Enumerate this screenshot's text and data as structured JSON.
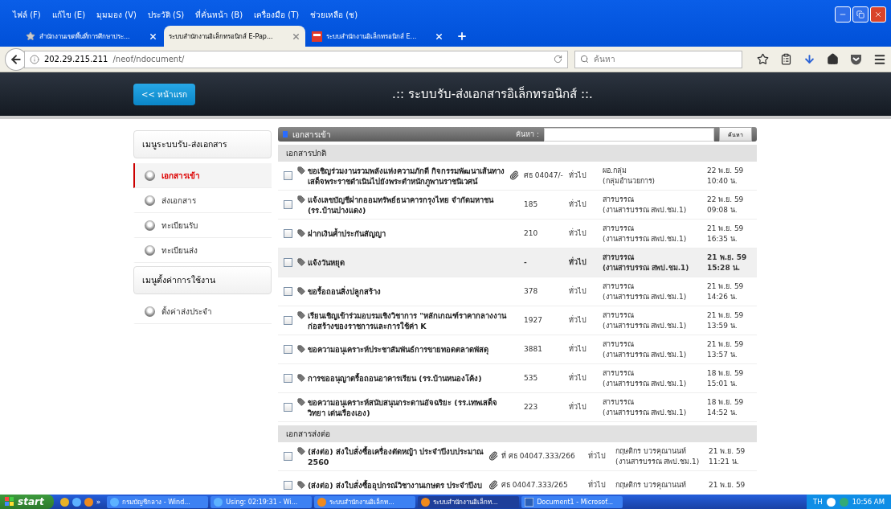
{
  "menu_bar": [
    "ไฟล์ (F)",
    "แก้ไข (E)",
    "มุมมอง (V)",
    "ประวัติ (S)",
    "ที่คั่นหน้า (B)",
    "เครื่องมือ (T)",
    "ช่วยเหลือ (ช)"
  ],
  "tabs": [
    {
      "label": "สำนักงานเขตพื้นที่การศึกษาประ...",
      "selected": false,
      "kind": "bookmark"
    },
    {
      "label": "ระบบสำนักงานอิเล็กทรอนิกส์ E-Pap...",
      "selected": true,
      "kind": "plain"
    },
    {
      "label": "ระบบสำนักงานอิเล็กทรอนิกส์ E...",
      "selected": false,
      "kind": "app"
    }
  ],
  "address_bar": {
    "host": "202.29.215.211",
    "path": "/neof/ndocument/"
  },
  "search": {
    "placeholder": "ค้นหา"
  },
  "header": {
    "home_button": "<< หน้าแรก",
    "title": ".:: ระบบรับ-ส่งเอกสารอิเล็กทรอนิกส์ ::."
  },
  "sidebar": {
    "menus": [
      {
        "title": "เมนูระบบรับ-ส่งเอกสาร",
        "items": [
          {
            "label": "เอกสารเข้า",
            "selected": true
          },
          {
            "label": "ส่งเอกสาร",
            "selected": false
          },
          {
            "label": "ทะเบียนรับ",
            "selected": false
          },
          {
            "label": "ทะเบียนส่ง",
            "selected": false
          }
        ]
      },
      {
        "title": "เมนูตั้งค่าการใช้งาน",
        "items": [
          {
            "label": "ตั้งค่าส่งประจำ",
            "selected": false
          }
        ]
      }
    ]
  },
  "inbox": {
    "title": "เอกสารเข้า",
    "search_label": "ค้นหา :",
    "search_button": "ค้นหา",
    "sections": [
      {
        "title": "เอกสารปกติ",
        "kind": "normal",
        "rows": [
          {
            "title": "ขอเชิญร่วมงานรวมพลังแห่งความภักดี กิจกรรมพัฒนาเส้นทางเสด็จพระราชดำเนินไปยังพระตำหนักภูพานราชนิเวศน์",
            "attachment": true,
            "number": "ศธ 04047/-",
            "type": "ทั่วไป",
            "sender": "ผอ.กลุ่ม",
            "sender_unit": "(กลุ่มอำนวยการ)",
            "date": "22 พ.ย. 59",
            "time": "10:40 น.",
            "highlighted": false
          },
          {
            "title": "แจ้งเลขบัญชีฝากออมทรัพย์ธนาคารกรุงไทย จำกัดมหาชน (รร.บ้านปางแดง)",
            "attachment": false,
            "number": "185",
            "type": "ทั่วไป",
            "sender": "สารบรรณ",
            "sender_unit": "(งานสารบรรณ สพป.ชม.1)",
            "date": "22 พ.ย. 59",
            "time": "09:08 น.",
            "highlighted": false
          },
          {
            "title": "ฝากเงินค้ำประกันสัญญา",
            "attachment": false,
            "number": "210",
            "type": "ทั่วไป",
            "sender": "สารบรรณ",
            "sender_unit": "(งานสารบรรณ สพป.ชม.1)",
            "date": "21 พ.ย. 59",
            "time": "16:35 น.",
            "highlighted": false
          },
          {
            "title": "แจ้งวันหยุด",
            "attachment": false,
            "number": "-",
            "type": "ทั่วไป",
            "sender": "สารบรรณ",
            "sender_unit": "(งานสารบรรณ สพป.ชม.1)",
            "date": "21 พ.ย. 59",
            "time": "15:28 น.",
            "highlighted": true
          },
          {
            "title": "ขอรื้อถอนสิ่งปลูกสร้าง",
            "attachment": false,
            "number": "378",
            "type": "ทั่วไป",
            "sender": "สารบรรณ",
            "sender_unit": "(งานสารบรรณ สพป.ชม.1)",
            "date": "21 พ.ย. 59",
            "time": "14:26 น.",
            "highlighted": false
          },
          {
            "title": "เรียนเชิญเข้าร่วมอบรมเชิงวิชาการ \"หลักเกณฑ์ราคากลางงานก่อสร้างของราชการและการใช้ค่า K",
            "attachment": false,
            "number": "1927",
            "type": "ทั่วไป",
            "sender": "สารบรรณ",
            "sender_unit": "(งานสารบรรณ สพป.ชม.1)",
            "date": "21 พ.ย. 59",
            "time": "13:59 น.",
            "highlighted": false
          },
          {
            "title": "ขอความอนุเคราะห์ประชาสัมพันธ์การขายทอดตลาดพัสดุ",
            "attachment": false,
            "number": "3881",
            "type": "ทั่วไป",
            "sender": "สารบรรณ",
            "sender_unit": "(งานสารบรรณ สพป.ชม.1)",
            "date": "21 พ.ย. 59",
            "time": "13:57 น.",
            "highlighted": false
          },
          {
            "title": "การขออนุญาตรื้อถอนอาคารเรียน (รร.บ้านหนองโค้ง)",
            "attachment": false,
            "number": "535",
            "type": "ทั่วไป",
            "sender": "สารบรรณ",
            "sender_unit": "(งานสารบรรณ สพป.ชม.1)",
            "date": "18 พ.ย. 59",
            "time": "15:01 น.",
            "highlighted": false
          },
          {
            "title": "ขอความอนุเคราะห์สนับสนุนกระดานอัจฉริยะ (รร.เทพเสด็จวิทยา เด่นเรืองเอง)",
            "attachment": false,
            "number": "223",
            "type": "ทั่วไป",
            "sender": "สารบรรณ",
            "sender_unit": "(งานสารบรรณ สพป.ชม.1)",
            "date": "18 พ.ย. 59",
            "time": "14:52 น.",
            "highlighted": false
          }
        ]
      },
      {
        "title": "เอกสารส่งต่อ",
        "kind": "forward",
        "rows": [
          {
            "title": "(ส่งต่อ) ส่งใบสั่งซื้อเครื่องตัดหญ้า ประจำปีงบประมาณ 2560",
            "attachment": true,
            "number": "ที่ ศธ 04047.333/266",
            "type": "ทั่วไป",
            "sender": "กฤษติกร บวรคุณานนท์",
            "sender_unit": "(งานสารบรรณ สพป.ชม.1)",
            "date": "21 พ.ย. 59",
            "time": "11:21 น.",
            "highlighted": false
          },
          {
            "title": "(ส่งต่อ) ส่งใบสั่งซื้ออุปกรณ์วิชางานเกษตร ประจำปีงบ",
            "attachment": true,
            "number": "ศธ 04047.333/265",
            "type": "ทั่วไป",
            "sender": "กฤษติกร บวรคุณานนท์",
            "date": "21 พ.ย. 59",
            "highlighted": false
          }
        ]
      }
    ]
  },
  "taskbar": {
    "start": "start",
    "more": "»",
    "tasks": [
      {
        "label": "กรมบัญชีกลาง - Wind...",
        "selected": false,
        "kind": "ie"
      },
      {
        "label": "Using: 02:19:31 - Wi...",
        "selected": false,
        "kind": "ie"
      },
      {
        "label": "ระบบสำนักงานอิเล็กท...",
        "selected": false,
        "kind": "firefox"
      },
      {
        "label": "ระบบสำนักงานอิเล็กท...",
        "selected": true,
        "kind": "firefox"
      },
      {
        "label": "Document1 - Microsof...",
        "selected": false,
        "kind": "word"
      }
    ],
    "language": "TH",
    "clock": "10:56 AM"
  }
}
